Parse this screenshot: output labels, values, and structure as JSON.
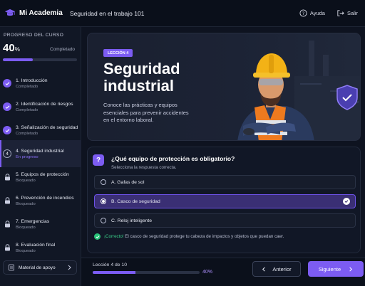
{
  "app": {
    "name": "Mi Academia"
  },
  "header": {
    "course_title": "Seguridad en el trabajo 101",
    "help_label": "Ayuda",
    "exit_label": "Salir"
  },
  "sidebar": {
    "progress_label": "PROGRESO DEL CURSO",
    "progress_value": "40",
    "progress_unit": "%",
    "progress_status": "Completado",
    "progress_fraction": 0.4,
    "modules": [
      {
        "title": "1. Introducción",
        "status": "Completado",
        "state": "done"
      },
      {
        "title": "2. Identificación de riesgos",
        "status": "Completado",
        "state": "done"
      },
      {
        "title": "3. Señalización de seguridad",
        "status": "Completado",
        "state": "done"
      },
      {
        "title": "4. Seguridad industrial",
        "status": "En progreso",
        "state": "current",
        "number": "4"
      },
      {
        "title": "5. Equipos de protección",
        "status": "Bloqueado",
        "state": "locked"
      },
      {
        "title": "6. Prevención de incendios",
        "status": "Bloqueado",
        "state": "locked"
      },
      {
        "title": "7. Emergencias",
        "status": "Bloqueado",
        "state": "locked"
      },
      {
        "title": "8. Evaluación final",
        "status": "Bloqueado",
        "state": "locked"
      }
    ],
    "support_label": "Material de apoyo"
  },
  "hero": {
    "badge": "LECCIÓN 4",
    "title": "Seguridad industrial",
    "description": "Conoce las prácticas y equipos esenciales para prevenir accidentes en el entorno laboral."
  },
  "question": {
    "icon_label": "?",
    "title": "¿Qué equipo de protección es obligatorio?",
    "hint": "Selecciona la respuesta correcta.",
    "options": [
      {
        "label": "A.  Gafas de sol",
        "selected": false
      },
      {
        "label": "B.  Casco de seguridad",
        "selected": true
      },
      {
        "label": "C.  Reloj inteligente",
        "selected": false
      }
    ],
    "feedback_strong": "¡Correcto!",
    "feedback_text": " El casco de seguridad protege tu cabeza de impactos y objetos que puedan caer."
  },
  "footer": {
    "lesson_count": "Lección 4 de 10",
    "lesson_percent": "40%",
    "lesson_fraction": 0.4,
    "prev_label": "Anterior",
    "next_label": "Siguiente"
  },
  "colors": {
    "accent": "#7c5cf2",
    "success": "#29c47a",
    "background": "#0e1320"
  }
}
